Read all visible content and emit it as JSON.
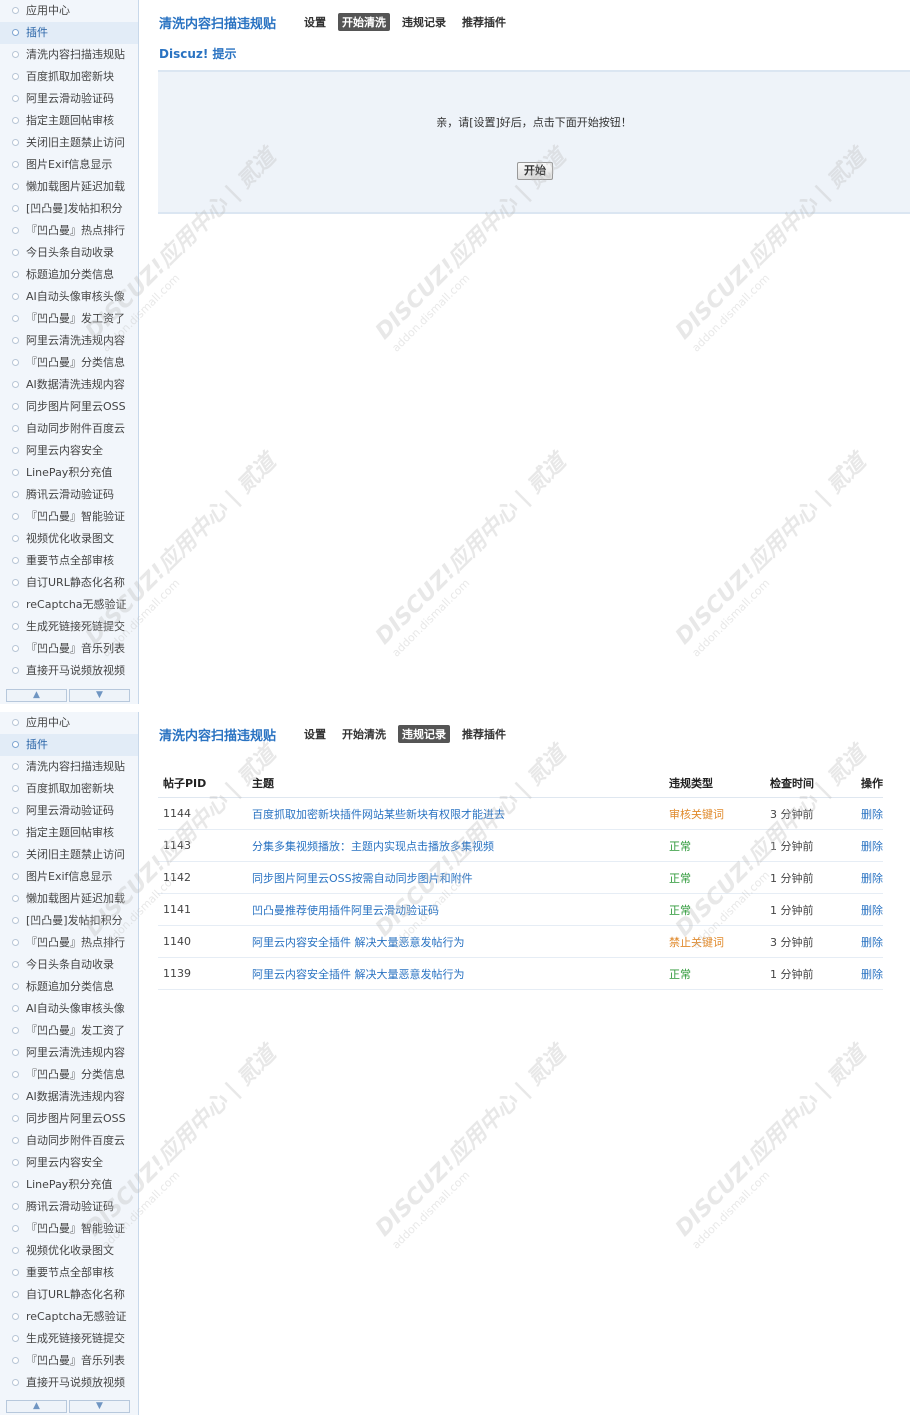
{
  "sidebar": {
    "items": [
      "应用中心",
      "插件",
      "清洗内容扫描违规贴",
      "百度抓取加密新块",
      "阿里云滑动验证码",
      "指定主题回帖审核",
      "关闭旧主题禁止访问",
      "图片Exif信息显示",
      "懒加载图片延迟加载",
      "[凹凸曼]发帖扣积分",
      "『凹凸曼』热点排行",
      "今日头条自动收录",
      "标题追加分类信息",
      "AI自动头像审核头像",
      "『凹凸曼』发工资了",
      "阿里云清洗违规内容",
      "『凹凸曼』分类信息",
      "AI数据清洗违规内容",
      "同步图片阿里云OSS",
      "自动同步附件百度云",
      "阿里云内容安全",
      "LinePay积分充值",
      "腾讯云滑动验证码",
      "『凹凸曼』智能验证",
      "视频优化收录图文",
      "重要节点全部审核",
      "自订URL静态化名称",
      "reCaptcha无感验证",
      "生成死链接死链提交",
      "『凹凸曼』音乐列表",
      "直接开马说频放视频"
    ],
    "active_index": 1,
    "scroll_up": "▲",
    "scroll_down": "▼"
  },
  "header": {
    "plugin_title": "清洗内容扫描违规贴",
    "tabs": [
      "设置",
      "开始清洗",
      "违规记录",
      "推荐插件"
    ]
  },
  "top_panel": {
    "active_tab": 1,
    "section_title": "Discuz! 提示",
    "tip_text": "亲，请[设置]好后，点击下面开始按钮！",
    "start_label": "开始"
  },
  "bottom_panel": {
    "active_tab": 2,
    "columns": [
      "帖子PID",
      "主题",
      "违规类型",
      "检查时间",
      "操作"
    ],
    "rows": [
      {
        "pid": "1144",
        "subject": "百度抓取加密新块插件网站某些新块有权限才能进去",
        "type": "审核关键词",
        "type_color": "#e08a2c",
        "time": "3 分钟前",
        "op": "删除"
      },
      {
        "pid": "1143",
        "subject": "分集多集视频播放：主题内实现点击播放多集视频",
        "type": "正常",
        "type_color": "#2f9a3a",
        "time": "1 分钟前",
        "op": "删除"
      },
      {
        "pid": "1142",
        "subject": "同步图片阿里云OSS按需自动同步图片和附件",
        "type": "正常",
        "type_color": "#2f9a3a",
        "time": "1 分钟前",
        "op": "删除"
      },
      {
        "pid": "1141",
        "subject": "凹凸曼推荐使用插件阿里云滑动验证码",
        "type": "正常",
        "type_color": "#2f9a3a",
        "time": "1 分钟前",
        "op": "删除"
      },
      {
        "pid": "1140",
        "subject": "阿里云内容安全插件 解决大量恶意发帖行为",
        "type": "禁止关键词",
        "type_color": "#e08a2c",
        "time": "3 分钟前",
        "op": "删除"
      },
      {
        "pid": "1139",
        "subject": "阿里云内容安全插件 解决大量恶意发帖行为",
        "type": "正常",
        "type_color": "#2f9a3a",
        "time": "1 分钟前",
        "op": "删除"
      }
    ]
  },
  "watermark": {
    "main": "DISCUZ!应用中心 | 贰道",
    "sub": "addon.dismall.com"
  }
}
